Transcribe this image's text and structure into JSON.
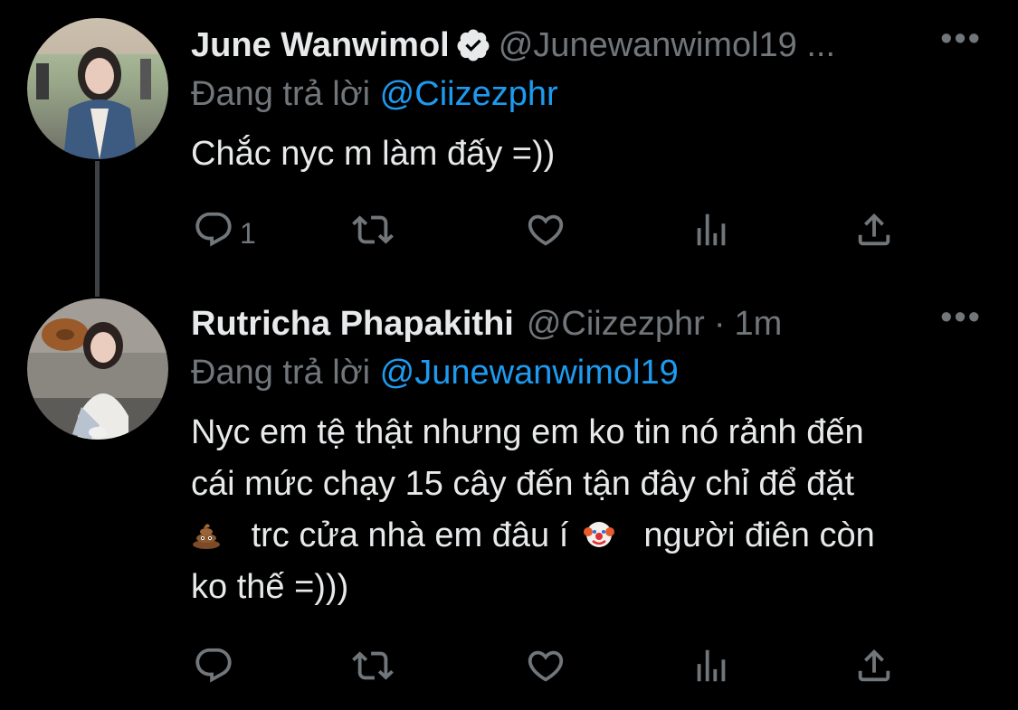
{
  "tweets": [
    {
      "name": "June Wanwimol",
      "handle": "@Junewanwimol19 ...",
      "more": "•••",
      "replying_prefix": "Đang trả lời",
      "replying_to": "@Ciizezphr",
      "text": "Chắc nyc m làm đấy =))",
      "reply_count": "1"
    },
    {
      "name": "Rutricha Phapakithi",
      "handle": "@Ciizezphr",
      "dot": "·",
      "time": "1m",
      "more": "•••",
      "replying_prefix": "Đang trả lời",
      "replying_to": "@Junewanwimol19",
      "text_line1": "Nyc em tệ thật nhưng em ko tin nó rảnh đến",
      "text_line2": "cái mức chạy 15 cây đến tận đây chỉ để đặt",
      "text_line3a": "trc cửa nhà em đâu í",
      "text_line3b": "người điên còn",
      "text_line4": "ko thế =)))"
    }
  ],
  "icons": {
    "reply": "reply-icon",
    "retweet": "retweet-icon",
    "like": "like-icon",
    "views": "views-icon",
    "share": "share-icon",
    "verified": "verified-badge-icon",
    "poop_emoji": "poop-emoji-icon",
    "clown_emoji": "clown-emoji-icon"
  },
  "colors": {
    "background": "#000000",
    "primary_text": "#e7e9ea",
    "secondary_text": "#71767b",
    "link": "#1d9bf0",
    "thread_line": "#3e4144"
  }
}
